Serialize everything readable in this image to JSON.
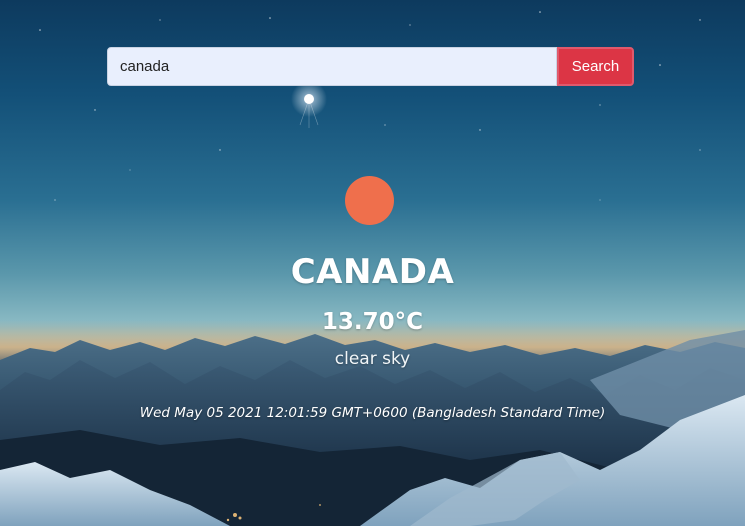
{
  "search": {
    "value": "canada",
    "button_label": "Search"
  },
  "weather": {
    "icon": "sun-icon",
    "icon_color": "#ef6f4c",
    "city": "CANADA",
    "temperature": "13.70°C",
    "condition": "clear sky",
    "datetime": "Wed May 05 2021 12:01:59 GMT+0600 (Bangladesh Standard Time)"
  },
  "colors": {
    "accent": "#dc3545",
    "input_background": "#e9effd"
  }
}
